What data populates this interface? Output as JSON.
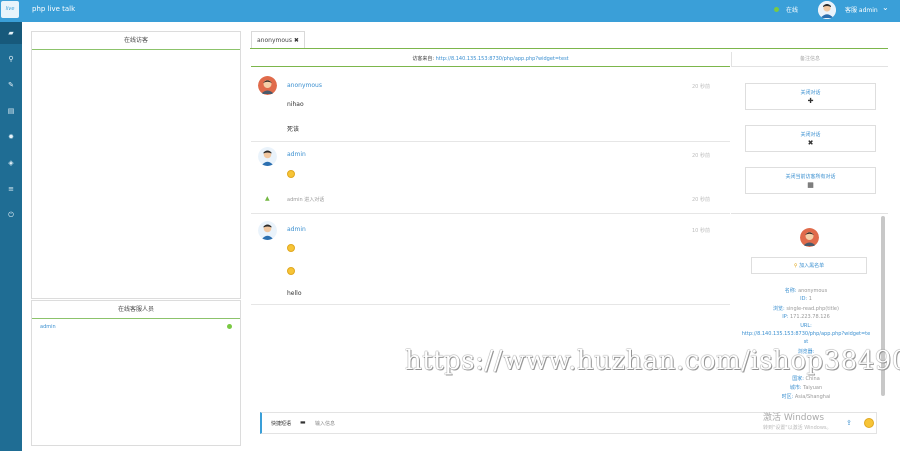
{
  "app": {
    "title": "php live talk",
    "logo_text": "live"
  },
  "topbar": {
    "status": "在线",
    "user": "客服  admin",
    "caret": "⌄"
  },
  "sidebar": {
    "items": [
      {
        "icon": "chat-icon",
        "glyph": "▰"
      },
      {
        "icon": "location-icon",
        "glyph": "⚲"
      },
      {
        "icon": "wrench-icon",
        "glyph": "✎"
      },
      {
        "icon": "list-icon",
        "glyph": "▤"
      },
      {
        "icon": "gear-icon",
        "glyph": "✹"
      },
      {
        "icon": "layers-icon",
        "glyph": "◈"
      },
      {
        "icon": "menu-icon",
        "glyph": "≡"
      },
      {
        "icon": "power-icon",
        "glyph": "⏻"
      }
    ]
  },
  "left": {
    "online_visitors_title": "在线访客",
    "online_staff_title": "在线客服人员",
    "staff": [
      {
        "name": "admin"
      }
    ]
  },
  "tabs": [
    {
      "label": "anonymous",
      "close": "✖"
    }
  ],
  "chat": {
    "url_prefix": "访客来自: ",
    "url": "http://8.140.135.153:8730/php/app.php?widget=test",
    "messages": [
      {
        "type": "msg",
        "name": "anonymous",
        "time": "20 秒前",
        "lines": [
          "nihao",
          "死该"
        ]
      },
      {
        "type": "msg",
        "name": "admin",
        "time": "20 秒前",
        "lines": [
          "emoji"
        ]
      },
      {
        "type": "system",
        "text": "admin 进入对话",
        "time": "20 秒前"
      },
      {
        "type": "msg",
        "name": "admin",
        "time": "10 秒前",
        "lines": [
          "emoji",
          "emoji",
          "hello"
        ]
      }
    ]
  },
  "input": {
    "quick_reply": "快捷短语",
    "placeholder": "输入信息"
  },
  "right": {
    "head": "备注信息",
    "actions": [
      {
        "label": "关闭对话",
        "icon": "✚"
      },
      {
        "label": "关闭对话",
        "icon": "✖"
      },
      {
        "label": "关闭当前访客所有对话",
        "icon": "▦"
      }
    ],
    "lock_label": "加入黑名单",
    "info": [
      {
        "k": "名称:",
        "v": "anonymous"
      },
      {
        "k": "ID:",
        "v": "1"
      },
      {
        "k": "浏览:",
        "v": "single-read.php(title)"
      },
      {
        "k": "IP:",
        "v": "171.223.78.126"
      },
      {
        "k": "URL:",
        "v": ""
      },
      {
        "k": "",
        "v": "http://8.140.135.153:8730/php/app.php?widget=te"
      },
      {
        "k": "",
        "v": "st"
      },
      {
        "k": "浏览器:",
        "v": ""
      },
      {
        "k": "国家:",
        "v": "China"
      },
      {
        "k": "城市:",
        "v": "Taiyuan"
      },
      {
        "k": "时区:",
        "v": "Asia/Shanghai"
      }
    ]
  },
  "overlay": {
    "watermark": "https://www.huzhan.com/ishop38490",
    "win_activate": "激活 Windows",
    "win_hint": "转到\"设置\"以激活 Windows。"
  }
}
